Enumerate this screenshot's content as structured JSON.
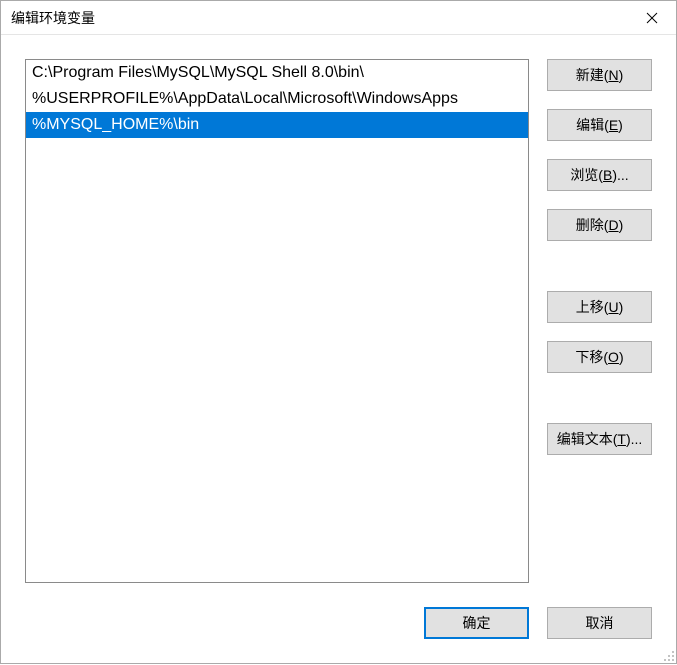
{
  "window": {
    "title": "编辑环境变量"
  },
  "list": {
    "items": [
      {
        "value": "C:\\Program Files\\MySQL\\MySQL Shell 8.0\\bin\\",
        "selected": false
      },
      {
        "value": "%USERPROFILE%\\AppData\\Local\\Microsoft\\WindowsApps",
        "selected": false
      },
      {
        "value": "%MYSQL_HOME%\\bin",
        "selected": true
      }
    ]
  },
  "buttons": {
    "new": {
      "label": "新建(",
      "hotkey": "N",
      "suffix": ")"
    },
    "edit": {
      "label": "编辑(",
      "hotkey": "E",
      "suffix": ")"
    },
    "browse": {
      "label": "浏览(",
      "hotkey": "B",
      "suffix": ")..."
    },
    "delete": {
      "label": "删除(",
      "hotkey": "D",
      "suffix": ")"
    },
    "move_up": {
      "label": "上移(",
      "hotkey": "U",
      "suffix": ")"
    },
    "move_down": {
      "label": "下移(",
      "hotkey": "O",
      "suffix": ")"
    },
    "edit_text": {
      "label": "编辑文本(",
      "hotkey": "T",
      "suffix": ")..."
    },
    "ok": {
      "label": "确定"
    },
    "cancel": {
      "label": "取消"
    }
  }
}
